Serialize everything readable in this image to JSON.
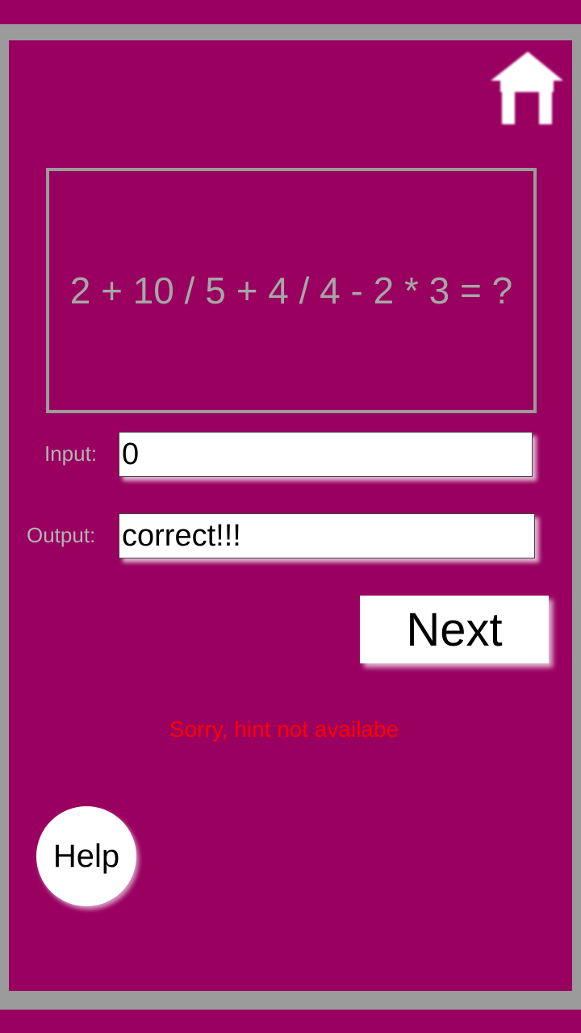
{
  "app": {
    "background_color": "#990060",
    "frame_color": "#9b9b9b"
  },
  "header": {
    "home_icon": "home-icon"
  },
  "question": {
    "text": "2 + 10 / 5 + 4 / 4 - 2 * 3 = ?"
  },
  "input": {
    "label": "Input:",
    "value": "0"
  },
  "output": {
    "label": "Output:",
    "value": "correct!!!"
  },
  "actions": {
    "next_label": "Next",
    "help_label": "Help"
  },
  "hint": {
    "text": "Sorry, hint not availabe",
    "color": "#ff0000"
  }
}
